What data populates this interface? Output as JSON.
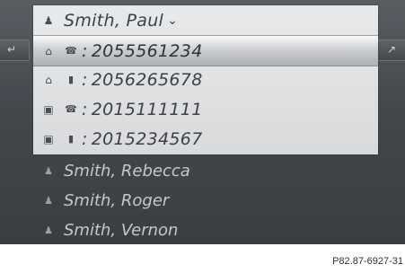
{
  "contacts_top": {
    "name": "Smith, Paul",
    "entries": [
      {
        "location_icon": "home-icon",
        "type_icon": "phone-icon",
        "number": "2055561234",
        "selected": true
      },
      {
        "location_icon": "home-icon",
        "type_icon": "mobile-icon",
        "number": "2056265678",
        "selected": false
      },
      {
        "location_icon": "office-icon",
        "type_icon": "phone-icon",
        "number": "2015111111",
        "selected": false
      },
      {
        "location_icon": "office-icon",
        "type_icon": "mobile-icon",
        "number": "2015234567",
        "selected": false
      }
    ]
  },
  "contacts_other": [
    {
      "name": "Smith, Rebecca"
    },
    {
      "name": "Smith, Roger"
    },
    {
      "name": "Smith, Vernon"
    }
  ],
  "separator": ":",
  "caption": "P82.87-6927-31",
  "colors": {
    "screen_bg": "#44484d",
    "panel_bg": "#dcdddf",
    "text_dark": "#3d4146",
    "text_light": "#c4c8cc"
  }
}
